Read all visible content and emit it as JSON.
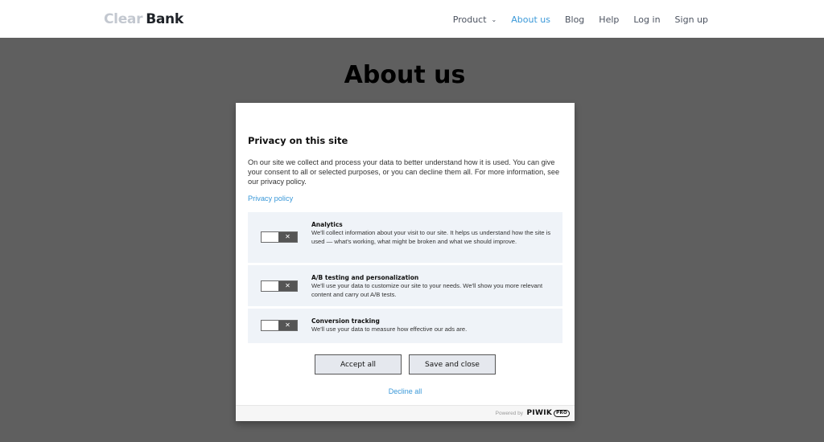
{
  "header": {
    "logo_light": "Clear",
    "logo_dark": "Bank",
    "nav": [
      {
        "label": "Product",
        "has_dropdown": true,
        "active": false
      },
      {
        "label": "About us",
        "active": true
      },
      {
        "label": "Blog",
        "active": false
      },
      {
        "label": "Help",
        "active": false
      },
      {
        "label": "Log in",
        "active": false
      },
      {
        "label": "Sign up",
        "active": false
      }
    ]
  },
  "page": {
    "title": "About us"
  },
  "modal": {
    "title": "Privacy on this site",
    "description": "On our site we collect and process your data to better understand how it is used. You can give your consent to all or selected purposes, or you can decline them all. For more information, see our privacy policy.",
    "policy_link": "Privacy policy",
    "options": [
      {
        "title": "Analytics",
        "description": "We'll collect information about your visit to our site. It helps us understand how the site is used — what's working, what might be broken and what we should improve.",
        "enabled": false,
        "toggle_glyph": "✕"
      },
      {
        "title": "A/B testing and personalization",
        "description": "We'll use your data to customize our site to your needs. We'll show you more relevant content and carry out A/B tests.",
        "enabled": false,
        "toggle_glyph": "✕"
      },
      {
        "title": "Conversion tracking",
        "description": "We'll use your data to measure how effective our ads are.",
        "enabled": false,
        "toggle_glyph": "✕"
      }
    ],
    "accept_label": "Accept all",
    "save_label": "Save and close",
    "decline_label": "Decline all",
    "footer": {
      "powered_by": "Powered by",
      "brand": "PIWIK",
      "brand_badge": "PRO"
    }
  },
  "colors": {
    "overlay": "#5f5f5f",
    "link": "#3a98d8",
    "option_bg": "#eff3f8",
    "button_bg": "#e5e8ee"
  }
}
